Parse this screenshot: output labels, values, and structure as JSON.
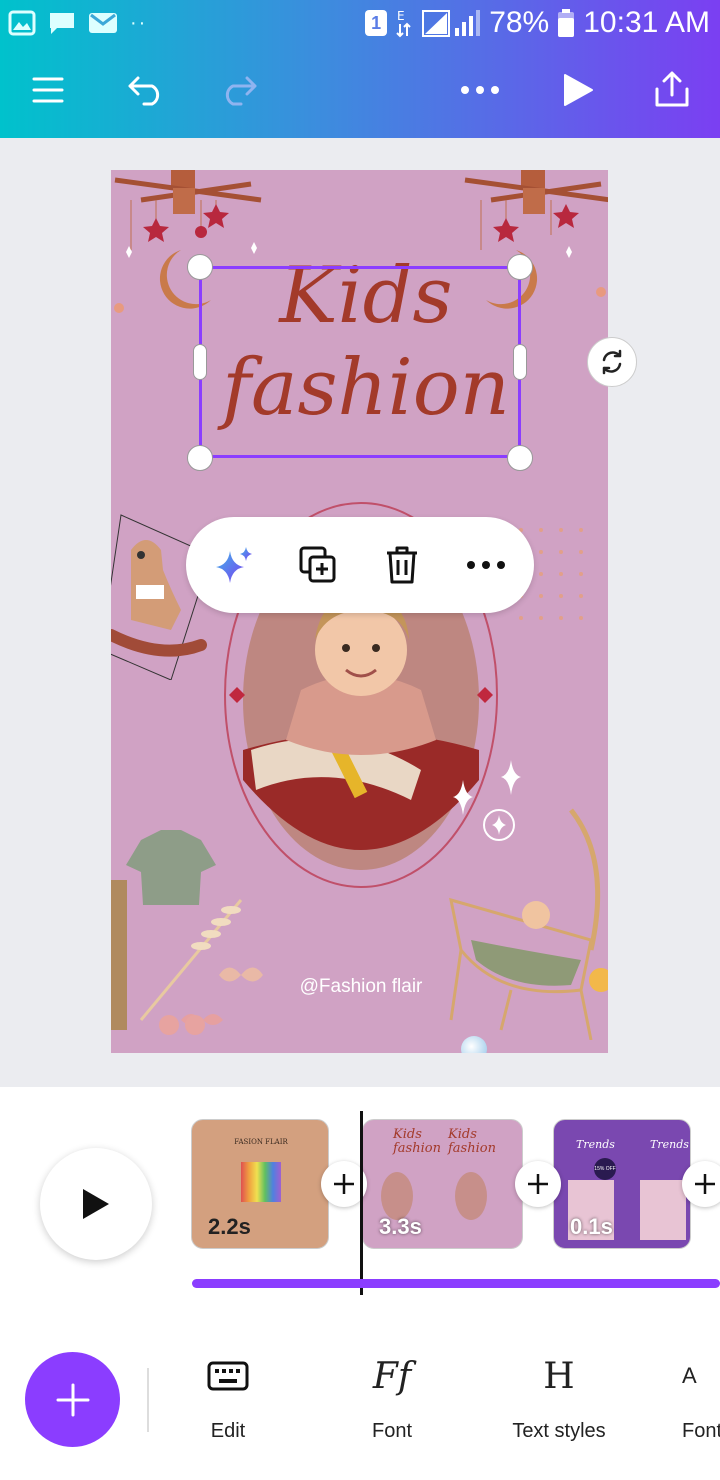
{
  "status_bar": {
    "battery": "78%",
    "time": "10:31 AM",
    "sim_badge": "1"
  },
  "toolbar": {
    "menu_icon": "hamburger-icon",
    "undo_icon": "undo-icon",
    "redo_icon": "redo-icon",
    "more_icon": "more-icon",
    "play_icon": "play-icon",
    "share_icon": "share-icon"
  },
  "canvas": {
    "title_line1": "Kids",
    "title_line2": "fashion",
    "handle_text": "@Fashion flair"
  },
  "float_menu": {
    "items": [
      "magic-icon",
      "duplicate-icon",
      "delete-icon",
      "more-icon"
    ]
  },
  "timeline": {
    "pages": [
      {
        "duration": "2.2s",
        "title": "FASION FLAIR"
      },
      {
        "duration": "3.3s",
        "title": "Kids fashion"
      },
      {
        "duration": "0.1s",
        "title": "Trends",
        "badge": "15% OFF"
      }
    ]
  },
  "tools": [
    {
      "label": "Edit",
      "icon": "keyboard-icon"
    },
    {
      "label": "Font",
      "icon": "Ff"
    },
    {
      "label": "Text styles",
      "icon": "H"
    },
    {
      "label": "Font",
      "icon": "A"
    }
  ]
}
